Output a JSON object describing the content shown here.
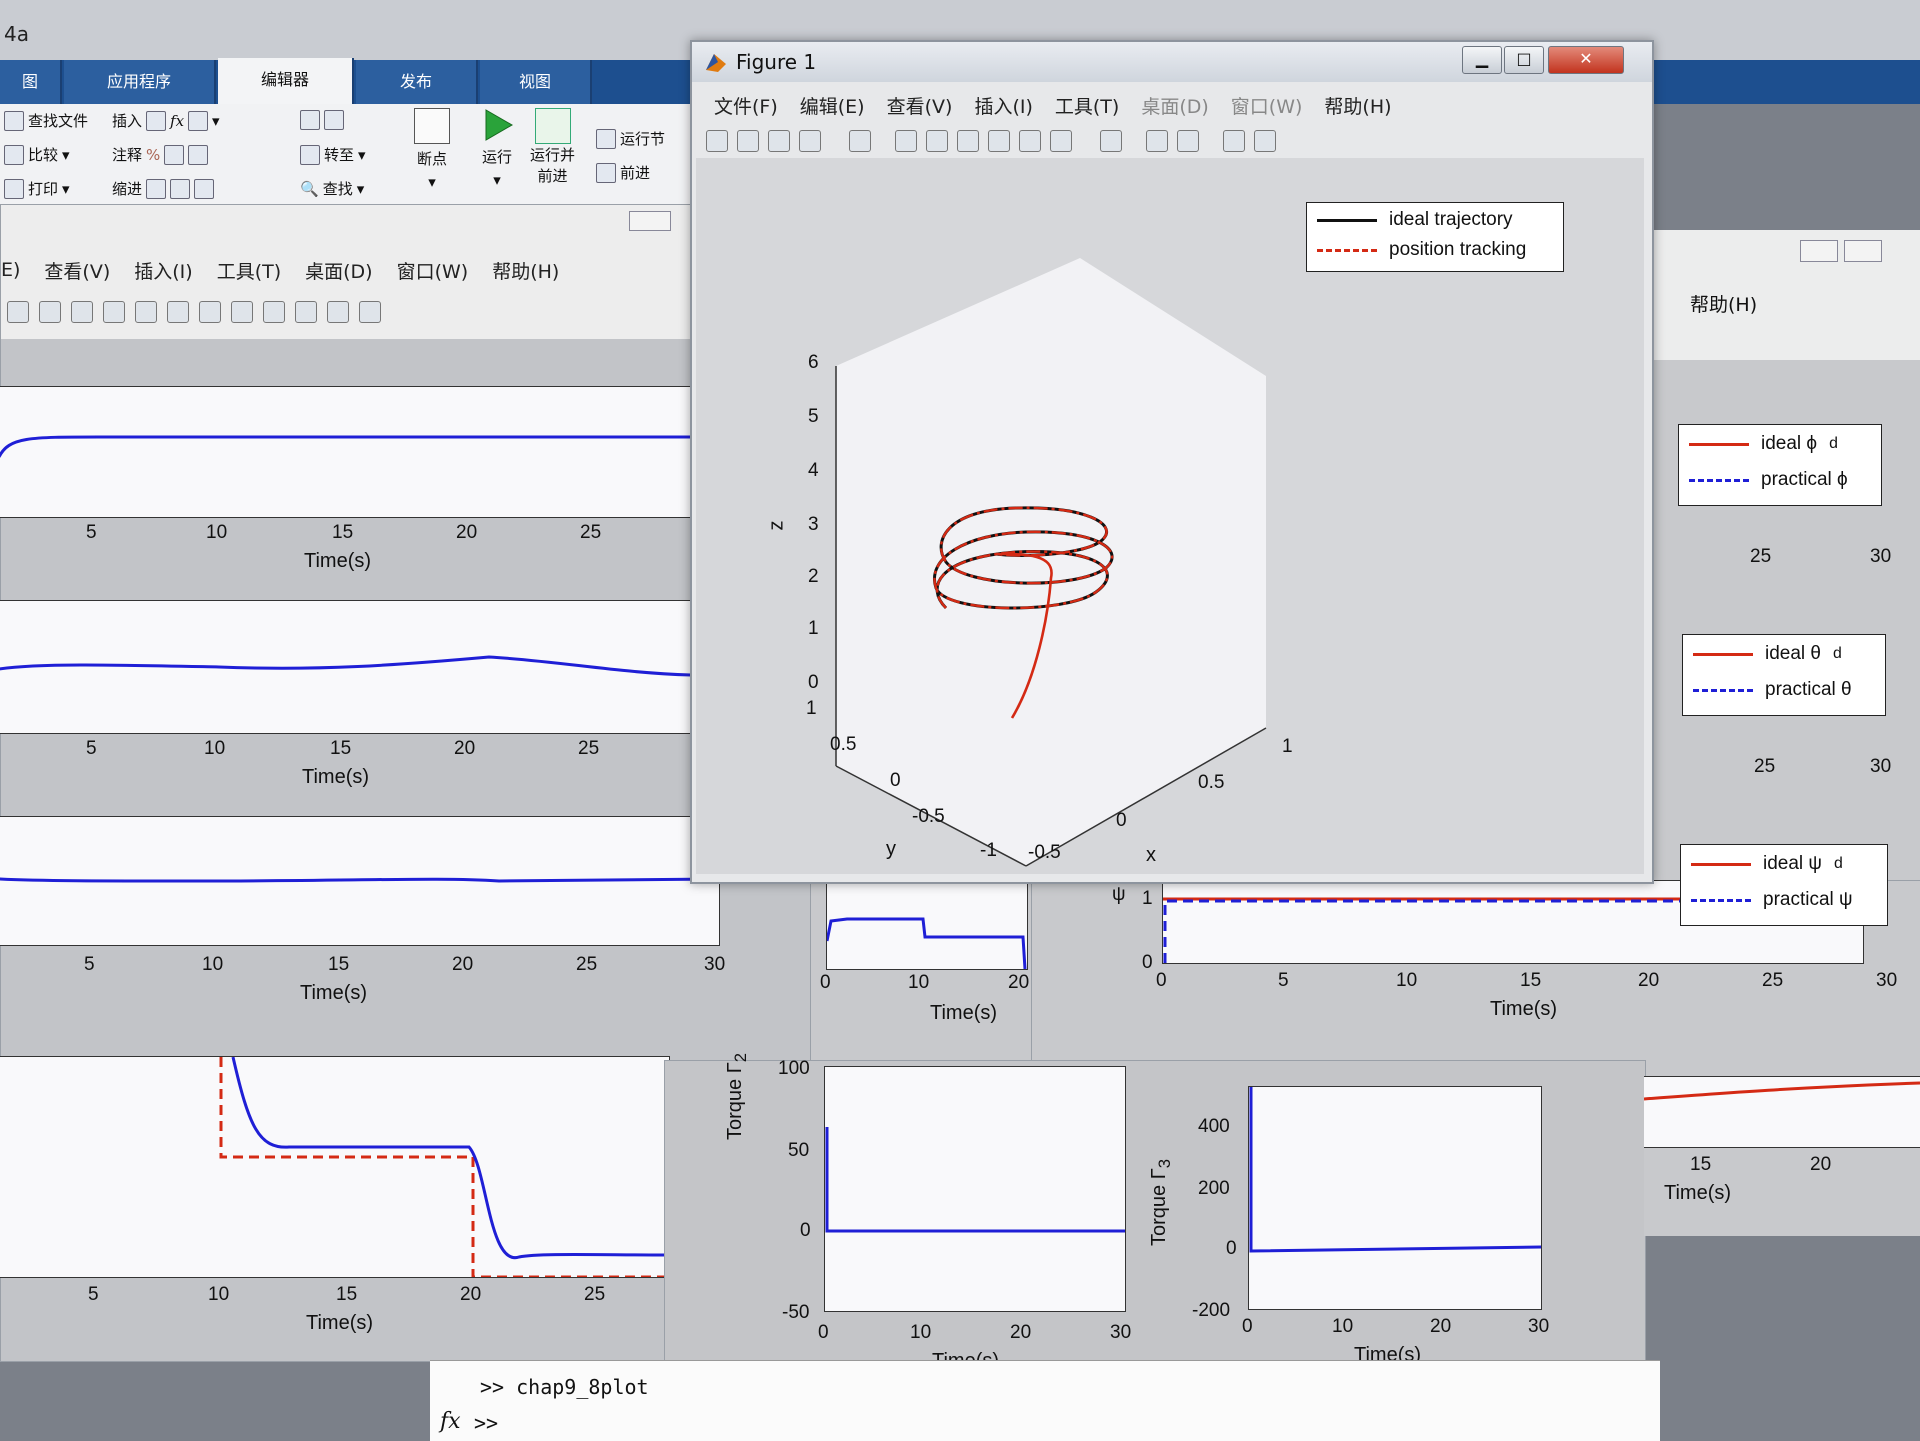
{
  "app": {
    "window_title_fragment": "4a"
  },
  "ribbon": {
    "tabs": [
      "图",
      "应用程序",
      "编辑器",
      "发布",
      "视图"
    ],
    "active_tab": "编辑器",
    "file_group": [
      "查找文件",
      "比较",
      "打印"
    ],
    "edit_group": [
      "插入",
      "注释",
      "缩进"
    ],
    "nav_group": [
      "转至",
      "查找"
    ],
    "breakpoint_label": "断点",
    "run_label": "运行",
    "run_advance_label": [
      "运行并",
      "前进"
    ],
    "run_section_label": "运行节",
    "advance_label": "前进"
  },
  "background_figure": {
    "menu": [
      "E)",
      "查看(V)",
      "插入(I)",
      "工具(T)",
      "桌面(D)",
      "窗口(W)",
      "帮助(H)"
    ],
    "time_label": "Time(s)",
    "x_ticks": [
      "5",
      "10",
      "15",
      "20",
      "25"
    ],
    "x_ticks_full": [
      "5",
      "10",
      "15",
      "20",
      "25",
      "30"
    ]
  },
  "figure1": {
    "title": "Figure 1",
    "menu": [
      "文件(F)",
      "编辑(E)",
      "查看(V)",
      "插入(I)",
      "工具(T)",
      "桌面(D)",
      "窗口(W)",
      "帮助(H)"
    ],
    "legend": [
      "ideal trajectory",
      "position tracking"
    ],
    "axis_labels": {
      "x": "x",
      "y": "y",
      "z": "z"
    },
    "z_ticks": [
      "6",
      "5",
      "4",
      "3",
      "2",
      "1",
      "0"
    ],
    "y_ticks": [
      "1",
      "0.5",
      "0",
      "-0.5",
      "-1"
    ],
    "x_ticks": [
      "-0.5",
      "0",
      "0.5",
      "1"
    ]
  },
  "right_figure": {
    "menu_help": "帮助(H)",
    "legend_phi": [
      "ideal ϕ",
      "d",
      "practical ϕ"
    ],
    "legend_theta": [
      "ideal θ",
      "d",
      "practical θ"
    ],
    "legend_psi": [
      "ideal ψ",
      "d",
      "practical ψ"
    ],
    "ticks_25_30": [
      "25",
      "30"
    ],
    "psi_y_ticks": [
      "1",
      "0"
    ],
    "psi_y_label": "ψ",
    "psi_x_ticks": [
      "0",
      "5",
      "10",
      "15",
      "20",
      "25",
      "30"
    ],
    "time_label": "Time(s)"
  },
  "torque_figure": {
    "t2_label": "Torque Γ",
    "t2_sub": "2",
    "t2_y_ticks": [
      "100",
      "50",
      "0",
      "-50"
    ],
    "t3_label": "Torque Γ",
    "t3_sub": "3",
    "t3_y_ticks": [
      "400",
      "200",
      "0",
      "-200"
    ],
    "x_ticks": [
      "0",
      "10",
      "20",
      "30"
    ],
    "time_label": "Time(s)",
    "mid_x_ticks": [
      "0",
      "10",
      "20"
    ],
    "right_x_ticks": [
      "15",
      "20"
    ]
  },
  "command_window": {
    "history": ">> chap9_8plot",
    "prompt": ">>",
    "fx": "fx"
  },
  "colors": {
    "series_blue": "#1f1fd6",
    "series_red": "#d42a14",
    "ideal_black": "#111111"
  }
}
